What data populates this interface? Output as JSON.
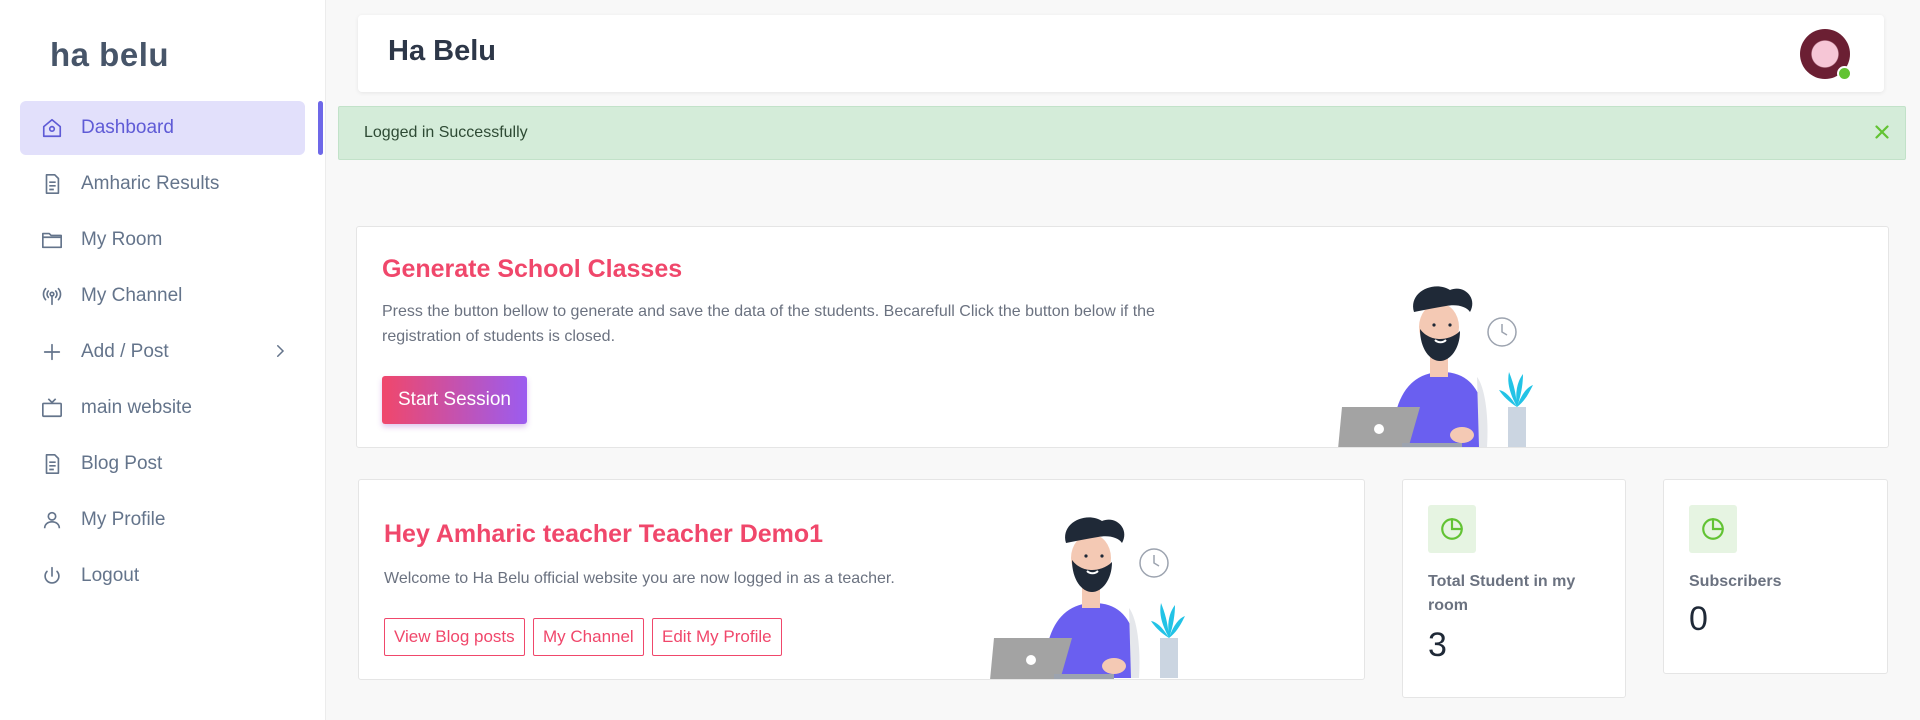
{
  "brand": "ha belu",
  "sidebar": {
    "items": [
      {
        "label": "Dashboard",
        "icon": "home-icon"
      },
      {
        "label": "Amharic Results",
        "icon": "document-icon"
      },
      {
        "label": "My Room",
        "icon": "folder-icon"
      },
      {
        "label": "My Channel",
        "icon": "broadcast-icon"
      },
      {
        "label": "Add / Post",
        "icon": "plus-icon"
      },
      {
        "label": "main website",
        "icon": "tv-icon"
      },
      {
        "label": "Blog Post",
        "icon": "document-icon"
      },
      {
        "label": "My Profile",
        "icon": "user-icon"
      },
      {
        "label": "Logout",
        "icon": "power-icon"
      }
    ],
    "active_index": 0
  },
  "header": {
    "title": "Ha Belu"
  },
  "alert": {
    "message": "Logged in Successfully"
  },
  "generate_card": {
    "title": "Generate School Classes",
    "text": "Press the button bellow to generate and save the data of the students. Becarefull Click the button below if the registration of students is closed.",
    "button": "Start Session"
  },
  "welcome_card": {
    "title": "Hey Amharic teacher Teacher Demo1",
    "text": "Welcome to Ha Belu official website you are now logged in as a teacher.",
    "buttons": [
      "View Blog posts",
      "My Channel",
      "Edit My Profile"
    ]
  },
  "stats": [
    {
      "label": "Total Student in my room",
      "value": "3",
      "icon": "pie-chart-icon"
    },
    {
      "label": "Subscribers",
      "value": "0",
      "icon": "pie-chart-icon"
    }
  ],
  "colors": {
    "accent": "#f0476b",
    "sidebar_active": "#5f5bd6",
    "alert_bg": "#d4ecd9",
    "stat_icon": "#62c333"
  }
}
